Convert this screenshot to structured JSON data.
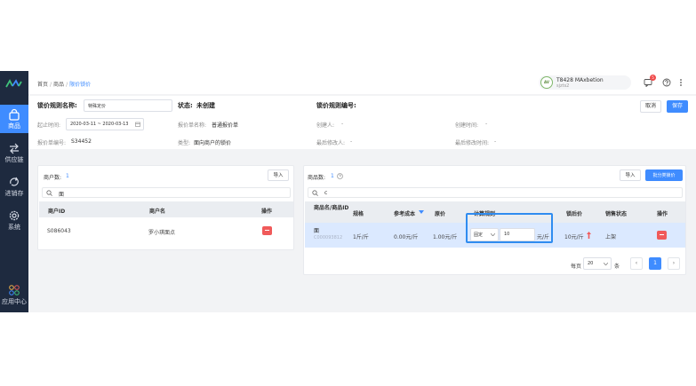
{
  "sidebar": {
    "items": [
      {
        "label": "商品",
        "icon": "shopping-bag-icon",
        "active": true
      },
      {
        "label": "供应链",
        "icon": "swap-arrows-icon"
      },
      {
        "label": "进销存",
        "icon": "cycle-icon"
      },
      {
        "label": "系统",
        "icon": "gear-icon"
      },
      {
        "label": "应用中心",
        "icon": "apps-icon"
      }
    ]
  },
  "header": {
    "breadcrumb": [
      "首页",
      "商品",
      "限价锁价"
    ],
    "user_name": "T8428 MAxbetion",
    "user_sub": "sjzts2",
    "user_avatar_text": "AV",
    "badge_count": "5"
  },
  "form": {
    "rule_name_label": "锁价规则名称:",
    "rule_name_value": "特殊定价",
    "status_label": "状态:",
    "status_value": "未创建",
    "rule_no_label": "锁价规则编号:",
    "time_label": "起止时间:",
    "time_value": "2020-03-11 ~ 2020-03-13",
    "quote_name_label": "报价单名称:",
    "quote_name_value": "普通报价单",
    "quote_no_label": "报价单编号:",
    "quote_no_value": "S34452",
    "type_label": "类型:",
    "type_value": "面向商户的锁价",
    "creator_label": "创建人:",
    "creator_value": "-",
    "create_time_label": "创建时间:",
    "create_time_value": "-",
    "modifier_label": "最后修改人:",
    "modifier_value": "-",
    "modify_time_label": "最后修改时间:",
    "modify_time_value": "-",
    "cancel_label": "取消",
    "save_label": "保存"
  },
  "merchants": {
    "count_label": "商户数:",
    "count": "1",
    "import_label": "导入",
    "search_value": "面",
    "columns": [
      "商户ID",
      "商户名",
      "操作"
    ],
    "rows": [
      {
        "id": "S086043",
        "name": "罗小琪面点"
      }
    ]
  },
  "products": {
    "count_label": "商品数:",
    "count": "1",
    "import_label": "导入",
    "batch_label": "批分类锁价",
    "search_value": "c",
    "columns": [
      "商品名/商品ID",
      "规格",
      "参考成本",
      "原价",
      "计算规则",
      "锁后价",
      "销售状态",
      "操作"
    ],
    "rows": [
      {
        "name": "面",
        "id": "C000093812",
        "spec": "1斤/斤",
        "ref_cost": "0.00元/斤",
        "orig_price": "1.00元/斤",
        "rule_mode": "固定",
        "rule_value": "10",
        "rule_unit": "元/斤",
        "locked_price": "10元/斤",
        "sale_status": "上架"
      }
    ],
    "page_size_label": "每页",
    "page_size": "20",
    "page_size_unit": "条",
    "current_page": "1"
  }
}
